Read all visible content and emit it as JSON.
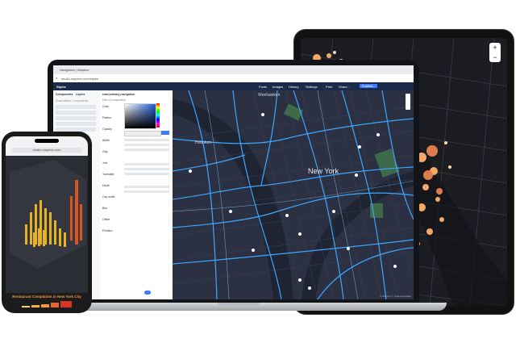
{
  "laptop": {
    "tab_title": "Navigation | Mapbox",
    "url": "studio.mapbox.com/styles",
    "nav": {
      "styles_label": "Styles",
      "items": [
        "Fonts",
        "Images",
        "History",
        "Settings",
        "Print",
        "Share...",
        "Publish..."
      ]
    },
    "left_panel": {
      "tabs": [
        "Components",
        "Layers"
      ],
      "search_placeholder": "Road labels, Components"
    },
    "mid_panel": {
      "title": "road primary-navigation",
      "subtitle": "Part of component",
      "sections": [
        "Color",
        "Pattern",
        "Opacity",
        "Width",
        "Gap",
        "Join",
        "Translate",
        "Depth",
        "Cap width",
        "Blur",
        "Offset",
        "Position"
      ]
    },
    "map_labels": {
      "hoboken": "Hoboken",
      "new_york": "New York",
      "weehawken": "Weehawken"
    },
    "attribution": "© Mapbox © OpenStreetMap"
  },
  "phone": {
    "url": "studio.mapbox.com",
    "title": "Restaurant Complaints in New York City"
  },
  "tablet": {
    "zoom_in": "+",
    "zoom_out": "−"
  },
  "colors": {
    "map_bg": "#2b3142",
    "road": "#3ea7ff",
    "accent_orange": "#f19a3e",
    "nav_bg": "#1a2a4a"
  }
}
